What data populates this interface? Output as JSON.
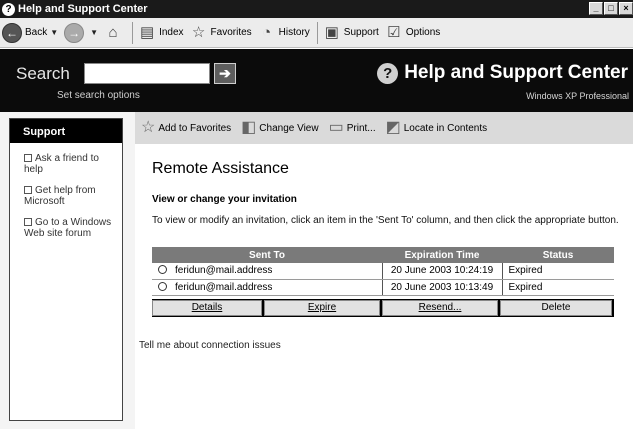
{
  "window": {
    "title": "Help and Support Center"
  },
  "toolbar": {
    "back": "Back",
    "index": "Index",
    "favorites": "Favorites",
    "history": "History",
    "support": "Support",
    "options": "Options"
  },
  "search": {
    "label": "Search",
    "value": "",
    "set_options": "Set search options"
  },
  "header": {
    "title": "Help and Support Center",
    "os": "Windows XP Professional"
  },
  "sidebar": {
    "title": "Support",
    "items": [
      {
        "label": "Ask a friend to help"
      },
      {
        "label": "Get help from Microsoft"
      },
      {
        "label": "Go to a Windows Web site forum"
      }
    ]
  },
  "actions": {
    "add_to_favorites": "Add to Favorites",
    "change_view": "Change View",
    "print": "Print...",
    "locate": "Locate in Contents"
  },
  "main": {
    "title": "Remote Assistance",
    "subtitle": "View or change your invitation",
    "instruction": "To view or modify an invitation, click an item in the 'Sent To' column, and then click the appropriate button.",
    "columns": [
      "Sent To",
      "Expiration Time",
      "Status"
    ],
    "rows": [
      {
        "sent_to": "feridun@mail.address",
        "expiration": "20 June 2003 10:24:19",
        "status": "Expired"
      },
      {
        "sent_to": "feridun@mail.address",
        "expiration": "20 June 2003 10:13:49",
        "status": "Expired"
      }
    ],
    "buttons": [
      "Details",
      "Expire",
      "Resend...",
      "Delete"
    ],
    "connection_link": "Tell me about connection issues"
  },
  "icons": {
    "window": "help-icon",
    "back": "back-arrow-icon",
    "forward": "forward-arrow-icon",
    "home": "home-icon",
    "index": "book-icon",
    "favorites": "star-icon",
    "history": "history-icon",
    "support": "support-icon",
    "options": "options-icon"
  }
}
